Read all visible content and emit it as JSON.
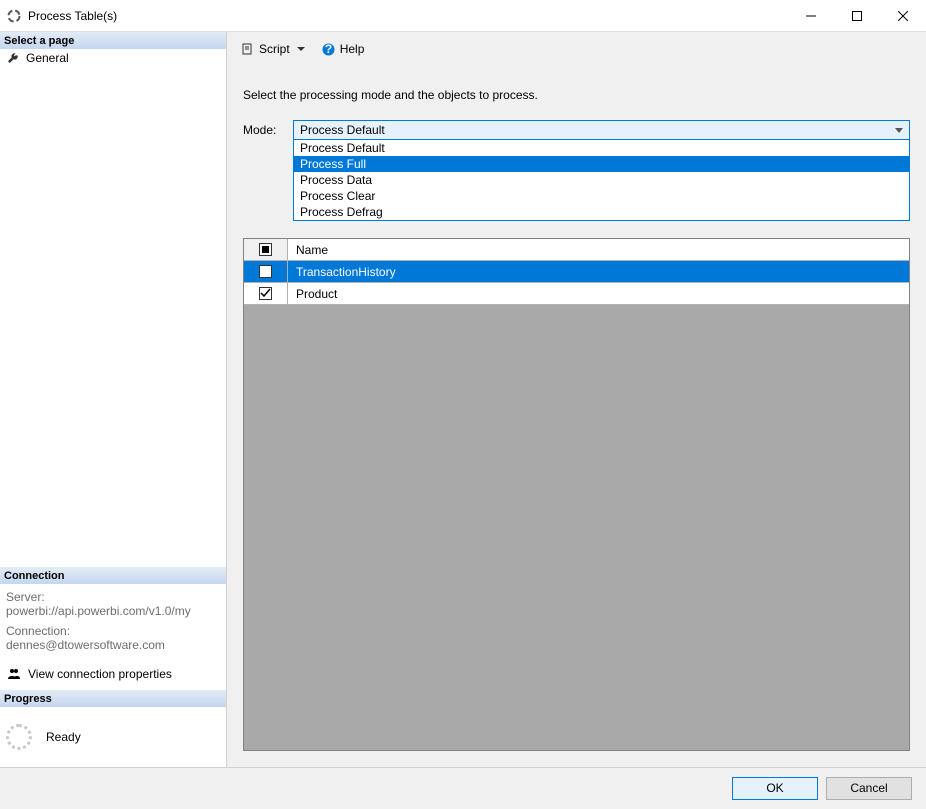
{
  "window": {
    "title": "Process Table(s)"
  },
  "sidebar": {
    "pages_header": "Select a page",
    "pages": [
      {
        "label": "General"
      }
    ],
    "connection_header": "Connection",
    "server_label": "Server:",
    "server_value": "powerbi://api.powerbi.com/v1.0/my",
    "connection_label": "Connection:",
    "connection_value": "dennes@dtowersoftware.com",
    "view_connection": "View connection properties",
    "progress_header": "Progress",
    "progress_status": "Ready"
  },
  "toolbar": {
    "script_label": "Script",
    "help_label": "Help"
  },
  "main": {
    "instruction": "Select the processing mode and the objects to process.",
    "mode_label": "Mode:",
    "mode_selected": "Process Default",
    "mode_options": [
      "Process Default",
      "Process Full",
      "Process Data",
      "Process Clear",
      "Process Defrag"
    ],
    "mode_highlight_index": 1,
    "grid": {
      "name_header": "Name",
      "rows": [
        {
          "name": "TransactionHistory",
          "checked": false,
          "selected": true
        },
        {
          "name": "Product",
          "checked": true,
          "selected": false
        }
      ]
    }
  },
  "footer": {
    "ok_label": "OK",
    "cancel_label": "Cancel"
  }
}
